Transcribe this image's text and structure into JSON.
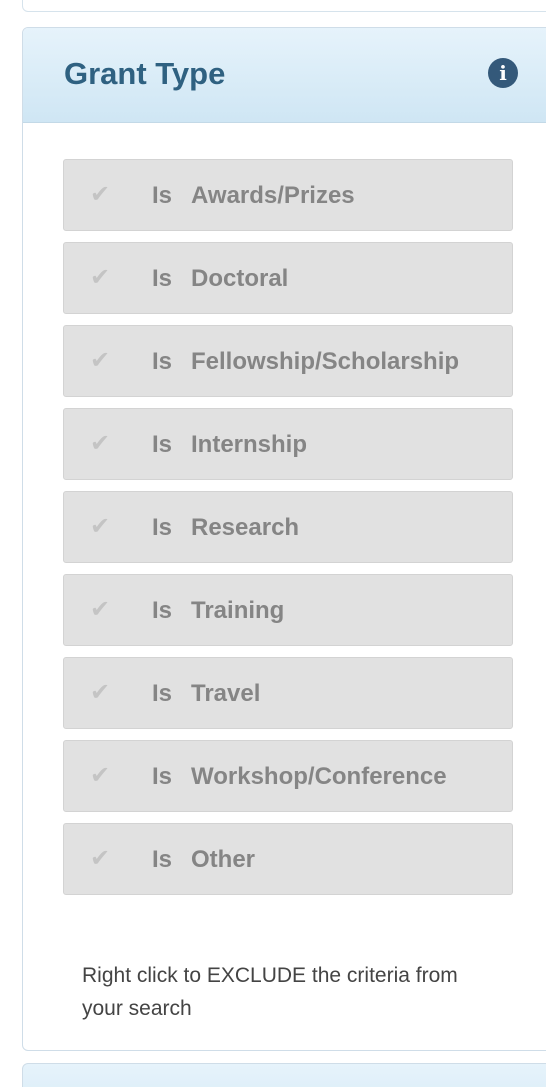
{
  "panel": {
    "title": "Grant Type",
    "info_icon": "i"
  },
  "options": [
    {
      "prefix": "Is",
      "label": "Awards/Prizes",
      "checked": false
    },
    {
      "prefix": "Is",
      "label": "Doctoral",
      "checked": false
    },
    {
      "prefix": "Is",
      "label": "Fellowship/Scholarship",
      "checked": false
    },
    {
      "prefix": "Is",
      "label": "Internship",
      "checked": false
    },
    {
      "prefix": "Is",
      "label": "Research",
      "checked": false
    },
    {
      "prefix": "Is",
      "label": "Training",
      "checked": false
    },
    {
      "prefix": "Is",
      "label": "Travel",
      "checked": false
    },
    {
      "prefix": "Is",
      "label": "Workshop/Conference",
      "checked": false
    },
    {
      "prefix": "Is",
      "label": "Other",
      "checked": false
    }
  ],
  "hint": "Right click to EXCLUDE the criteria from your search",
  "icons": {
    "check": "check-icon",
    "info": "info-icon"
  },
  "colors": {
    "title": "#2f6181",
    "header_bg": "#d7ebf7",
    "option_bg": "#e1e1e1",
    "option_text": "#858585",
    "info_icon_bg": "#34597a"
  }
}
